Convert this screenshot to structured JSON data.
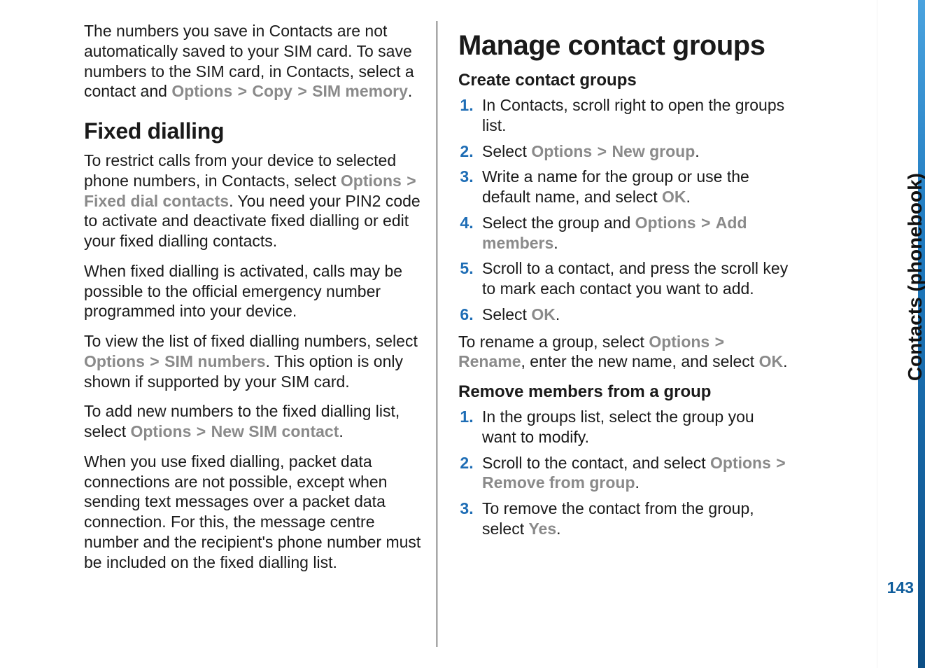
{
  "sidebar": {
    "chapter": "Contacts (phonebook)",
    "page_number": "143"
  },
  "ui": {
    "options": "Options",
    "copy": "Copy",
    "sim_memory": "SIM memory",
    "fixed_dial_contacts": "Fixed dial contacts",
    "sim_numbers": "SIM numbers",
    "new_sim_contact": "New SIM contact",
    "new_group": "New group",
    "ok": "OK",
    "add_members": "Add members",
    "rename": "Rename",
    "remove_from_group": "Remove from group",
    "yes": "Yes",
    "gt": ">"
  },
  "left": {
    "intro_a": "The numbers you save in Contacts are not automatically saved to your SIM card. To save numbers to the SIM card, in Contacts, select a contact and ",
    "intro_b": ".",
    "h_fixed": "Fixed dialling",
    "p1a": "To restrict calls from your device to selected phone numbers, in Contacts, select ",
    "p1b": ". You need your PIN2 code to activate and deactivate fixed dialling or edit your fixed dialling contacts.",
    "p2": "When fixed dialling is activated, calls may be possible to the official emergency number programmed into your device.",
    "p3a": "To view the list of fixed dialling numbers, select ",
    "p3b": ". This option is only shown if supported by your SIM card.",
    "p4a": "To add new numbers to the fixed dialling list, select ",
    "p4b": ".",
    "p5": "When you use fixed dialling, packet data connections are not possible, except when sending text messages over a packet data connection. For this, the message centre number and the recipient's phone number must be included on the fixed dialling list."
  },
  "right": {
    "h_manage": "Manage contact groups",
    "h_create": "Create contact groups",
    "step1": "In Contacts, scroll right to open the groups list.",
    "step2a": "Select ",
    "step2b": ".",
    "step3a": "Write a name for the group or use the default name, and select ",
    "step3b": ".",
    "step4a": "Select the group and ",
    "step4b": ".",
    "step5": "Scroll to a contact, and press the scroll key to mark each contact you want to add.",
    "step6a": "Select ",
    "step6b": ".",
    "rename_a": "To rename a group, select ",
    "rename_b": ", enter the new name, and select ",
    "rename_c": ".",
    "h_remove": "Remove members from a group",
    "rstep1": "In the groups list, select the group you want to modify.",
    "rstep2a": "Scroll to the contact, and select ",
    "rstep2b": ".",
    "rstep3a": "To remove the contact from the group, select ",
    "rstep3b": "."
  }
}
